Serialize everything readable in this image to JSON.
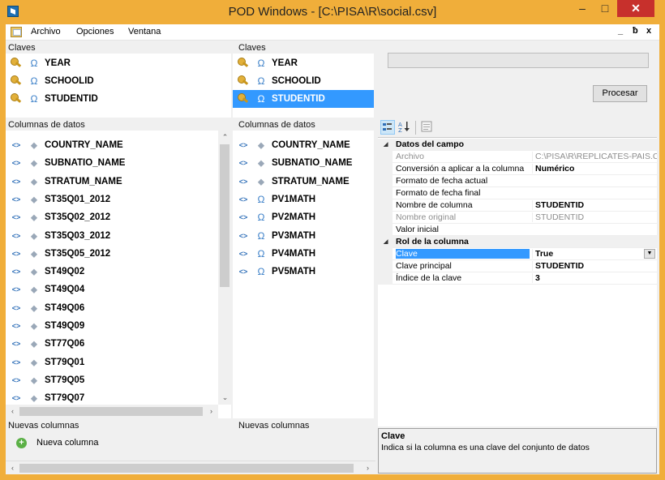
{
  "window": {
    "title": "POD Windows - [C:\\PISA\\R\\social.csv]",
    "min": "–",
    "max": "□",
    "close": "✕"
  },
  "menu": {
    "items": [
      "Archivo",
      "Opciones",
      "Ventana"
    ],
    "mdi_min": "_",
    "mdi_restore": "ƀ",
    "mdi_close": "x"
  },
  "left": {
    "keys_label": "Claves",
    "keys": [
      "YEAR",
      "SCHOOLID",
      "STUDENTID"
    ],
    "data_label": "Columnas de datos",
    "columns": [
      "COUNTRY_NAME",
      "SUBNATIO_NAME",
      "STRATUM_NAME",
      "ST35Q01_2012",
      "ST35Q02_2012",
      "ST35Q03_2012",
      "ST35Q05_2012",
      "ST49Q02",
      "ST49Q04",
      "ST49Q06",
      "ST49Q09",
      "ST77Q06",
      "ST79Q01",
      "ST79Q05",
      "ST79Q07"
    ],
    "new_label": "Nuevas columnas",
    "new_item": "Nueva columna"
  },
  "mid": {
    "keys_label": "Claves",
    "keys": [
      "YEAR",
      "SCHOOLID",
      "STUDENTID"
    ],
    "selected_key": "STUDENTID",
    "data_label": "Columnas de datos",
    "columns": [
      "COUNTRY_NAME",
      "SUBNATIO_NAME",
      "STRATUM_NAME",
      "PV1MATH",
      "PV2MATH",
      "PV3MATH",
      "PV4MATH",
      "PV5MATH"
    ],
    "new_label": "Nuevas columnas"
  },
  "right": {
    "process_button": "Procesar",
    "grid": {
      "cat1": "Datos del campo",
      "rows1": [
        {
          "name": "Archivo",
          "value": "C:\\PISA\\R\\REPLICATES-PAIS.CS",
          "disabled": true,
          "bold": false
        },
        {
          "name": "Conversión a aplicar a la columna",
          "value": "Numérico",
          "disabled": false,
          "bold": true
        },
        {
          "name": "Formato de fecha actual",
          "value": "",
          "disabled": false,
          "bold": false
        },
        {
          "name": "Formato de fecha final",
          "value": "",
          "disabled": false,
          "bold": false
        },
        {
          "name": "Nombre de columna",
          "value": "STUDENTID",
          "disabled": false,
          "bold": true
        },
        {
          "name": "Nombre original",
          "value": "STUDENTID",
          "disabled": true,
          "bold": false
        },
        {
          "name": "Valor inicial",
          "value": "",
          "disabled": false,
          "bold": false
        }
      ],
      "cat2": "Rol de la columna",
      "rows2": [
        {
          "name": "Clave",
          "value": "True"
        },
        {
          "name": "Clave principal",
          "value": "STUDENTID"
        },
        {
          "name": "Índice de la clave",
          "value": "3"
        }
      ]
    },
    "help_title": "Clave",
    "help_desc": "Indica si la columna es una clave del conjunto de datos"
  },
  "colors": {
    "accent": "#f0ae3a",
    "selection": "#3399ff",
    "close": "#c7302c"
  }
}
